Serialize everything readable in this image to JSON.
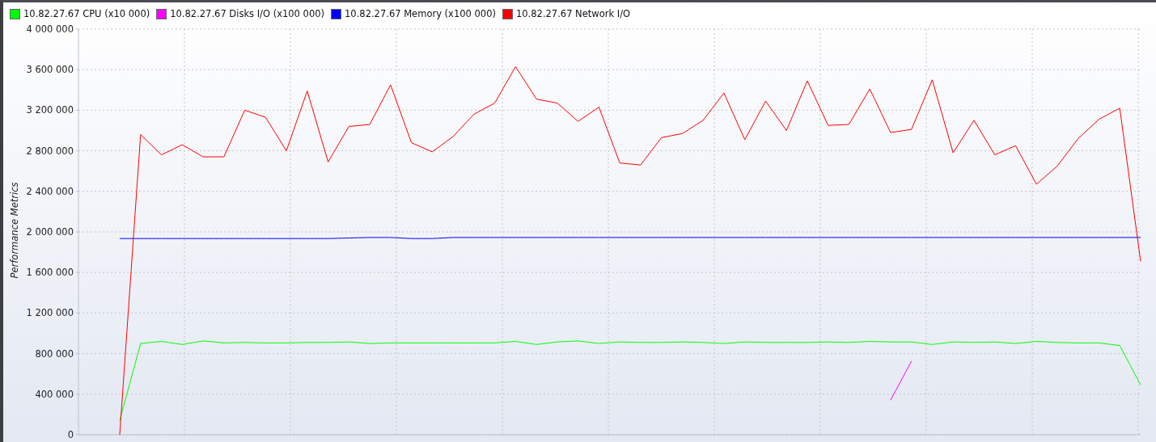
{
  "chart": {
    "chart_data": {
      "type": "line",
      "grid": true,
      "ylabel": "Performance Metrics",
      "ylim": [
        0,
        4000000
      ],
      "yticks": [
        {
          "value": 0,
          "label": "0"
        },
        {
          "value": 400000,
          "label": "400 000"
        },
        {
          "value": 800000,
          "label": "800 000"
        },
        {
          "value": 1200000,
          "label": "1 200 000"
        },
        {
          "value": 1600000,
          "label": "1 600 000"
        },
        {
          "value": 2000000,
          "label": "2 000 000"
        },
        {
          "value": 2400000,
          "label": "2 400 000"
        },
        {
          "value": 2800000,
          "label": "2 800 000"
        },
        {
          "value": 3200000,
          "label": "3 200 000"
        },
        {
          "value": 3600000,
          "label": "3 600 000"
        },
        {
          "value": 4000000,
          "label": "4 000 000"
        }
      ],
      "series": [
        {
          "name": "10.82.27.67 CPU (x10 000)",
          "color": "#00ff00",
          "values": [
            140000,
            900000,
            920000,
            890000,
            925000,
            905000,
            910000,
            905000,
            905000,
            910000,
            910000,
            915000,
            900000,
            905000,
            905000,
            905000,
            905000,
            905000,
            905000,
            920000,
            890000,
            915000,
            925000,
            900000,
            915000,
            910000,
            910000,
            915000,
            910000,
            900000,
            915000,
            910000,
            910000,
            910000,
            915000,
            910000,
            920000,
            915000,
            915000,
            890000,
            915000,
            910000,
            915000,
            900000,
            920000,
            910000,
            905000,
            905000,
            880000,
            490000
          ]
        },
        {
          "name": "10.82.27.67 Disks I/O (x100 000)",
          "color": "#ff00ff",
          "values": [
            null,
            null,
            null,
            null,
            null,
            null,
            null,
            null,
            null,
            null,
            null,
            null,
            null,
            null,
            null,
            null,
            null,
            null,
            null,
            null,
            null,
            null,
            null,
            null,
            null,
            null,
            null,
            null,
            null,
            null,
            null,
            null,
            null,
            null,
            null,
            null,
            null,
            340000,
            725000,
            null,
            null,
            null,
            null,
            null,
            null,
            null,
            null,
            null,
            null,
            null
          ]
        },
        {
          "name": "10.82.27.67 Memory (x100 000)",
          "color": "#0000ff",
          "values": [
            1935000,
            1935000,
            1935000,
            1935000,
            1935000,
            1935000,
            1935000,
            1935000,
            1935000,
            1935000,
            1935000,
            1940000,
            1945000,
            1945000,
            1935000,
            1935000,
            1945000,
            1945000,
            1945000,
            1945000,
            1945000,
            1945000,
            1945000,
            1945000,
            1945000,
            1945000,
            1945000,
            1945000,
            1945000,
            1945000,
            1945000,
            1945000,
            1945000,
            1945000,
            1945000,
            1945000,
            1945000,
            1945000,
            1945000,
            1945000,
            1945000,
            1945000,
            1945000,
            1945000,
            1945000,
            1945000,
            1945000,
            1945000,
            1945000,
            1945000
          ]
        },
        {
          "name": "10.82.27.67 Network I/O",
          "color": "#ff0000",
          "values": [
            0,
            2960000,
            2760000,
            2860000,
            2740000,
            2740000,
            3200000,
            3130000,
            2800000,
            3390000,
            2690000,
            3040000,
            3060000,
            3450000,
            2880000,
            2790000,
            2940000,
            3160000,
            3270000,
            3630000,
            3310000,
            3270000,
            3090000,
            3230000,
            2680000,
            2660000,
            2930000,
            2970000,
            3100000,
            3370000,
            2910000,
            3290000,
            3000000,
            3490000,
            3050000,
            3060000,
            3410000,
            2980000,
            3010000,
            3500000,
            2780000,
            3100000,
            2760000,
            2850000,
            2470000,
            2650000,
            2920000,
            3110000,
            3220000,
            1710000
          ]
        }
      ]
    }
  }
}
